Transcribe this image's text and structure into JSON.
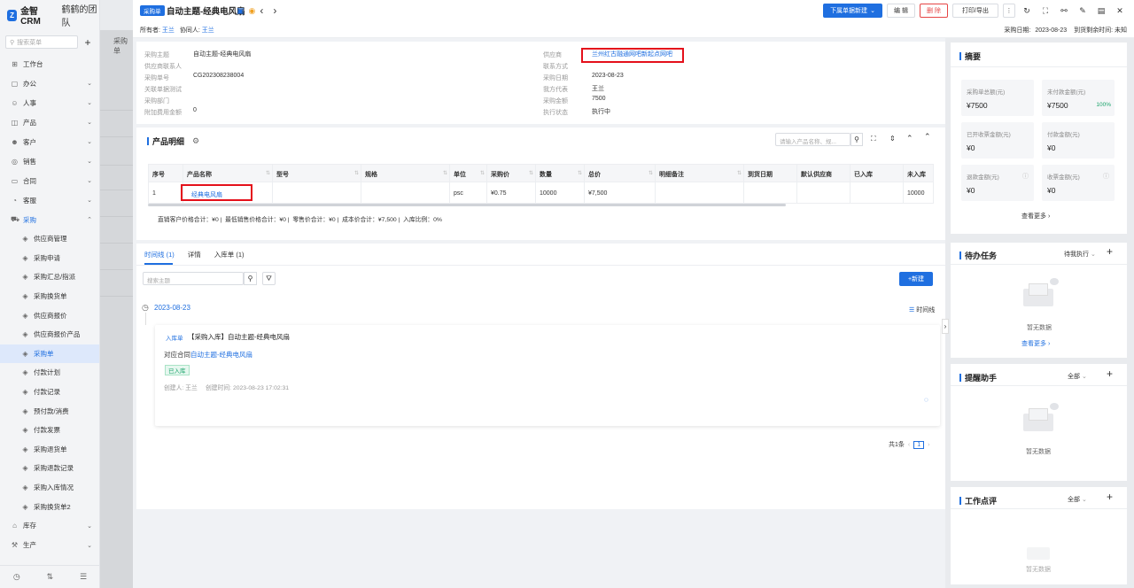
{
  "brand": {
    "name": "金智CRM",
    "team": "鹤鹤的团队"
  },
  "menu_search_placeholder": "搜索菜单",
  "menu": [
    {
      "label": "工作台",
      "icon": "grid-icon"
    },
    {
      "label": "办公",
      "icon": "briefcase-icon",
      "chevron": true
    },
    {
      "label": "人事",
      "icon": "person-icon",
      "chevron": true
    },
    {
      "label": "产品",
      "icon": "box-icon",
      "chevron": true
    },
    {
      "label": "客户",
      "icon": "customer-icon",
      "chevron": true
    },
    {
      "label": "销售",
      "icon": "sales-icon",
      "chevron": true
    },
    {
      "label": "合同",
      "icon": "contract-icon",
      "chevron": true
    },
    {
      "label": "客服",
      "icon": "service-icon",
      "chevron": true
    },
    {
      "label": "采购",
      "icon": "cart-icon",
      "chevron": true,
      "open": true
    }
  ],
  "submenu": [
    "供应商管理",
    "采购申请",
    "采购汇总/指派",
    "采购换货单",
    "供应商报价",
    "供应商报价产品",
    "采购单",
    "付款计划",
    "付款记录",
    "预付款/消费",
    "付款发票",
    "采购退货单",
    "采购退款记录",
    "采购入库情况",
    "采购换货单2"
  ],
  "submenu_active": "采购单",
  "menu_bottom": [
    {
      "label": "库存",
      "icon": "warehouse-icon"
    },
    {
      "label": "生产",
      "icon": "factory-icon"
    }
  ],
  "bg_title": "采购单",
  "header": {
    "tag": "采购单",
    "title": "自动主题-经典电风扇",
    "owner_label": "所有者:",
    "owner": "王兰",
    "helper_label": "协同人:",
    "helper": "王兰",
    "buttons": {
      "create": "下属单据新建",
      "edit": "编 辑",
      "delete": "删 除",
      "print": "打印/导出"
    },
    "date_label": "采购日期:",
    "date": "2023-08-23",
    "remain_label": "到货剩余时间:",
    "remain": "未知"
  },
  "info": {
    "left": [
      {
        "label": "采购主题",
        "value": "自动主题-经典电风扇"
      },
      {
        "label": "供应商联系人",
        "value": ""
      },
      {
        "label": "采购单号",
        "value": "CG202308238004"
      },
      {
        "label": "关联单据测试",
        "value": ""
      },
      {
        "label": "采购部门",
        "value": ""
      },
      {
        "label": "附加费用金额",
        "value": "0"
      }
    ],
    "right": [
      {
        "label": "供应商",
        "value": "兰州红古融通网吧新起点网吧"
      },
      {
        "label": "联系方式",
        "value": ""
      },
      {
        "label": "采购日期",
        "value": "2023-08-23"
      },
      {
        "label": "我方代表",
        "value": "王兰"
      },
      {
        "label": "采购金额",
        "value": "7500"
      },
      {
        "label": "执行状态",
        "value": "执行中"
      }
    ]
  },
  "products": {
    "title": "产品明细",
    "search_placeholder": "请输入产品名称、规...",
    "columns": [
      "序号",
      "产品名称",
      "型号",
      "规格",
      "单位",
      "采购价",
      "数量",
      "总价",
      "明细备注",
      "到货日期",
      "默认供应商",
      "已入库",
      "未入库"
    ],
    "rows": [
      [
        "1",
        "经典电风扇",
        "",
        "",
        "psc",
        "¥0.75",
        "10000",
        "¥7,500",
        "",
        "",
        "",
        "",
        "10000"
      ]
    ],
    "summary": "直销客户价格合计：¥0 |  最低销售价格合计：¥0 |  零售价合计：¥0 |  成本价合计：¥7,500 |  入库比例：0%"
  },
  "tabs": [
    "时间线 (1)",
    "详情",
    "入库单 (1)"
  ],
  "timeline": {
    "search_placeholder": "搜索主题",
    "new_button": "新建",
    "date": "2023-08-23",
    "view_label": "时间线",
    "item": {
      "type_tag": "入库单",
      "title": "【采购入库】自动主题-经典电风扇",
      "contract_label": "对应合同",
      "contract": "自动主题-经典电风扇",
      "status": "已入库",
      "creator": "创建人: 王兰",
      "created": "创建时间: 2023-08-23 17:02:31"
    },
    "pager": {
      "total": "共1条",
      "page": "1"
    }
  },
  "summary": {
    "title": "摘要",
    "cards": [
      {
        "label": "采购单总额(元)",
        "value": "¥7500"
      },
      {
        "label": "未付款金额(元)",
        "value": "¥7500",
        "extra": "100%"
      },
      {
        "label": "已开收票金额(元)",
        "value": "¥0"
      },
      {
        "label": "付款金额(元)",
        "value": "¥0"
      },
      {
        "label": "退款金额(元)",
        "value": "¥0"
      },
      {
        "label": "收票金额(元)",
        "value": "¥0"
      }
    ],
    "more": "查看更多"
  },
  "todo": {
    "title": "待办任务",
    "filter": "待我执行",
    "empty": "暂无数据",
    "more": "查看更多"
  },
  "reminder": {
    "title": "提醒助手",
    "filter": "全部",
    "empty": "暂无数据"
  },
  "review": {
    "title": "工作点评",
    "filter": "全部",
    "empty": "暂无数据"
  }
}
